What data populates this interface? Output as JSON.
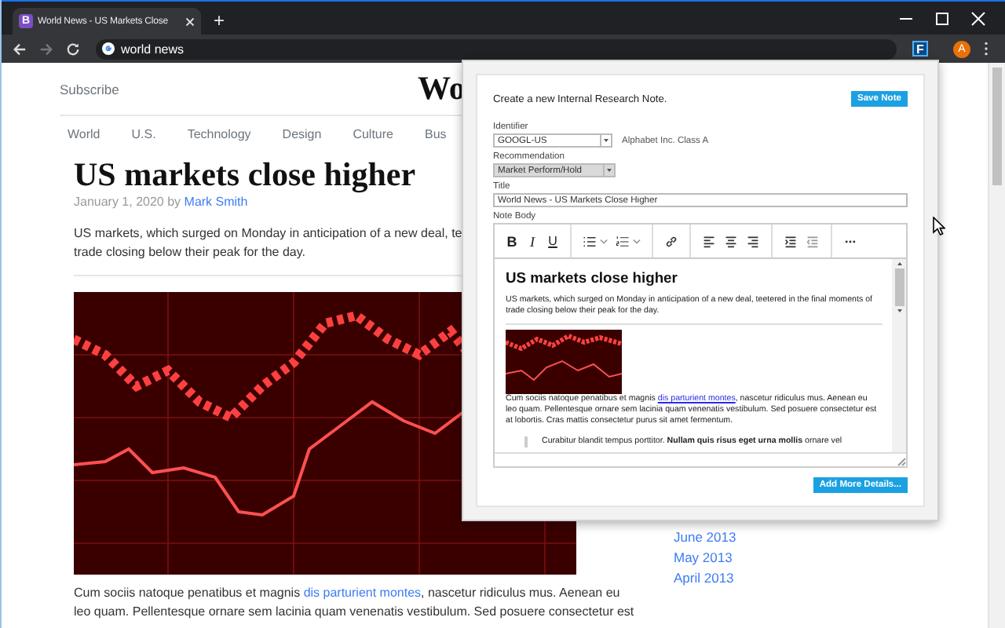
{
  "browser": {
    "tab": {
      "favicon": "B",
      "title": "World News - US Markets Close"
    },
    "new_tab": "+",
    "forward_disabled": true,
    "address": "world news",
    "extension": "F",
    "profile": "A"
  },
  "page": {
    "subscribe": "Subscribe",
    "site_title": "Wo",
    "nav": [
      "World",
      "U.S.",
      "Technology",
      "Design",
      "Culture",
      "Bus"
    ],
    "headline": "US markets close higher",
    "date": "January 1, 2020 by",
    "author": "Mark Smith",
    "lede_lines": [
      "US markets, which surged on Monday in anticipation of a new deal, te",
      "trade closing below their peak for the day."
    ],
    "body_lines": [
      {
        "before": "Cum sociis natoque penatibus et magnis ",
        "link": "dis parturient montes",
        "after": ", nascetur ridiculus mus. Aenean eu"
      },
      {
        "before": "leo quam. Pellentesque ornare sem lacinia quam venenatis vestibulum. Sed posuere consectetur est"
      }
    ],
    "archive": [
      "June 2013",
      "May 2013",
      "April 2013"
    ]
  },
  "note_popup": {
    "heading": "Create a new Internal Research Note.",
    "save_button": "Save Note",
    "identifier": {
      "label": "Identifier",
      "value": "GOOGL-US",
      "description": "Alphabet Inc. Class A"
    },
    "recommendation": {
      "label": "Recommendation",
      "value": "Market Perform/Hold"
    },
    "title": {
      "label": "Title",
      "value": "World News - US Markets Close Higher"
    },
    "note_body": {
      "label": "Note Body",
      "format_buttons": [
        "B",
        "I",
        "U"
      ],
      "heading": "US markets close higher",
      "lede_lines": [
        "US markets, which surged on Monday in anticipation of a new deal, teetered in the final moments of",
        "trade closing below their peak for the day."
      ],
      "body_lines": [
        {
          "before": "Cum sociis natoque penatibus et magnis ",
          "link": "dis parturient montes",
          "after": ", nascetur ridiculus mus. Aenean eu"
        },
        {
          "before": "leo quam. Pellentesque ornare sem lacinia quam venenatis vestibulum. Sed posuere consectetur est"
        },
        {
          "before": "at lobortis. Cras mattis consectetur purus sit amet fermentum."
        }
      ],
      "quote": "Curabitur blandit tempus porttitor. **Nullam quis risus eget urna mollis** ornare vel"
    },
    "details_button": "Add More Details..."
  }
}
